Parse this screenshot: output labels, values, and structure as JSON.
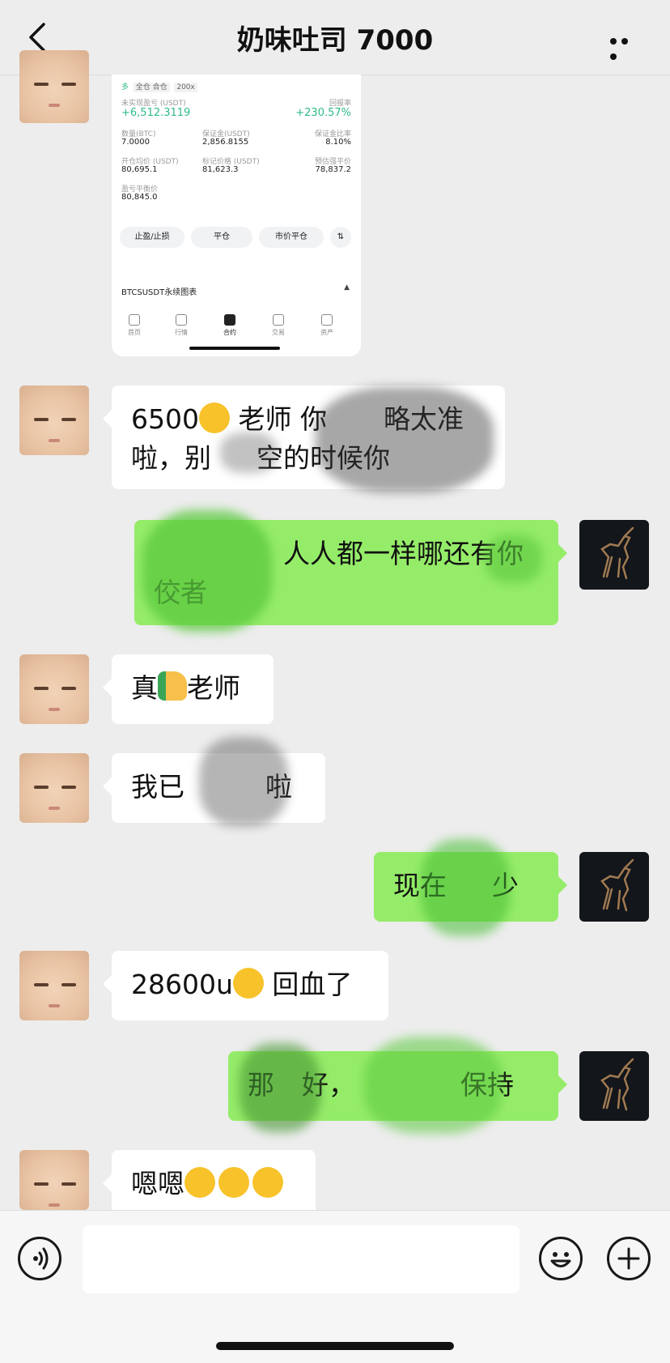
{
  "header": {
    "title": "奶味吐司 7000"
  },
  "card": {
    "tags": [
      "多",
      "全仓 合仓",
      "200x"
    ],
    "unrealized_label": "未实现盈亏 (USDT)",
    "unrealized_value": "+6,512.3119",
    "roi_label": "回报率",
    "roi_value": "+230.57%",
    "qty_label": "数量(BTC)",
    "qty_value": "7.0000",
    "margin_label": "保证金(USDT)",
    "margin_value": "2,856.8155",
    "margin_ratio_label": "保证金比率",
    "margin_ratio_value": "8.10%",
    "open_price_label": "开仓均价 (USDT)",
    "open_price_value": "80,695.1",
    "mark_price_label": "标记价格 (USDT)",
    "mark_price_value": "81,623.3",
    "liq_price_label": "预估强平价",
    "liq_price_value": "78,837.2",
    "breakeven_label": "盈亏平衡价",
    "breakeven_value": "80,845.0",
    "buttons": [
      "止盈/止损",
      "平仓",
      "市价平仓"
    ],
    "chart_link": "BTCSUSDT永续图表",
    "tabs": [
      "首页",
      "行情",
      "合约",
      "交易",
      "资产"
    ]
  },
  "messages": [
    {
      "side": "left",
      "line1": "6500",
      "line1b": " 老师 你",
      "line1c": "略太准",
      "line2": "啦，别",
      "line2b": "空的时候你"
    },
    {
      "side": "right",
      "line1": "人人都一样哪还有你",
      "line2": "佼者"
    },
    {
      "side": "left",
      "text_a": "真",
      "text_b": "老师"
    },
    {
      "side": "left",
      "text_a": "我已",
      "text_b": "啦"
    },
    {
      "side": "right",
      "text_a": "现在",
      "text_b": "少"
    },
    {
      "side": "left",
      "text_a": "28600u",
      "text_b": " 回血了"
    },
    {
      "side": "right",
      "text_a": "那",
      "text_b": "好，",
      "text_c": "保持"
    },
    {
      "side": "left",
      "text_a": "嗯嗯"
    }
  ],
  "colors": {
    "bubble_green": "#95ec69",
    "positive": "#2ebd85"
  }
}
